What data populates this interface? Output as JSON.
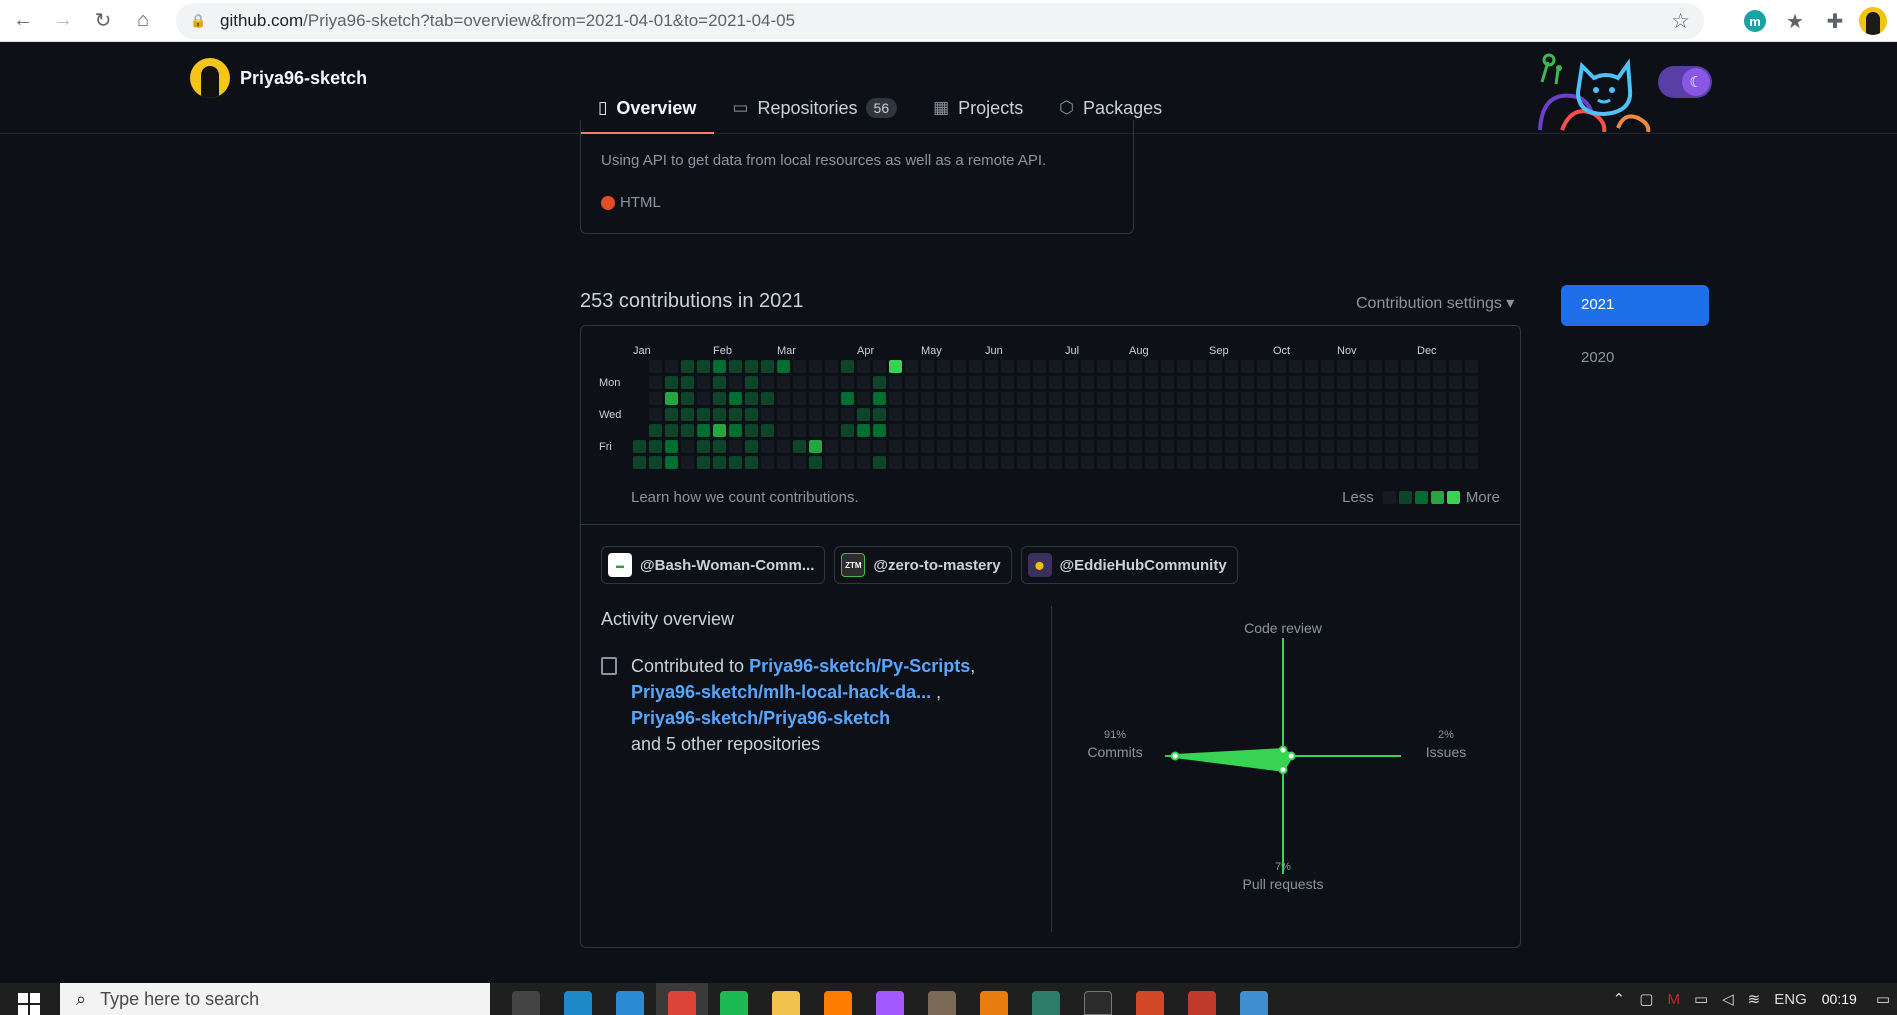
{
  "browser": {
    "url_host": "github.com",
    "url_path": "/Priya96-sketch?tab=overview&from=2021-04-01&to=2021-04-05",
    "extensions": [
      "m-extension-icon",
      "star-icon",
      "puzzle-icon"
    ]
  },
  "profile": {
    "username": "Priya96-sketch"
  },
  "tabs": [
    {
      "label": "Overview",
      "icon": "book-icon"
    },
    {
      "label": "Repositories",
      "icon": "repo-icon",
      "count": "56"
    },
    {
      "label": "Projects",
      "icon": "project-icon"
    },
    {
      "label": "Packages",
      "icon": "package-icon"
    }
  ],
  "pinned": {
    "description": "Using API to get data from local resources as well as a remote API.",
    "language": "HTML",
    "language_color": "#e34c26"
  },
  "contributions": {
    "title": "253 contributions in 2021",
    "settings_label": "Contribution settings",
    "months": [
      "Jan",
      "Feb",
      "Mar",
      "Apr",
      "May",
      "Jun",
      "Jul",
      "Aug",
      "Sep",
      "Oct",
      "Nov",
      "Dec"
    ],
    "day_labels": [
      "Mon",
      "Wed",
      "Fri"
    ],
    "learn_text": "Learn how we count contributions.",
    "legend_less": "Less",
    "legend_more": "More",
    "level_colors": [
      "#161b22",
      "#0e4429",
      "#006d32",
      "#26a641",
      "#39d353"
    ],
    "weeks": [
      [
        0,
        0,
        0,
        0,
        0,
        1,
        1
      ],
      [
        0,
        0,
        0,
        0,
        1,
        1,
        1
      ],
      [
        0,
        1,
        3,
        1,
        1,
        2,
        2
      ],
      [
        1,
        1,
        1,
        1,
        1,
        0,
        0
      ],
      [
        1,
        0,
        0,
        1,
        2,
        1,
        1
      ],
      [
        2,
        1,
        1,
        1,
        3,
        1,
        1
      ],
      [
        1,
        0,
        2,
        1,
        2,
        0,
        1
      ],
      [
        1,
        1,
        1,
        1,
        1,
        1,
        1
      ],
      [
        1,
        0,
        1,
        0,
        1,
        0,
        0
      ],
      [
        2,
        0,
        0,
        0,
        0,
        0,
        0
      ],
      [
        0,
        0,
        0,
        0,
        0,
        1,
        0
      ],
      [
        0,
        0,
        0,
        0,
        0,
        3,
        1
      ],
      [
        0,
        0,
        0,
        0,
        0,
        0,
        0
      ],
      [
        1,
        0,
        2,
        0,
        1,
        0,
        0
      ],
      [
        0,
        0,
        0,
        1,
        2,
        0,
        0
      ],
      [
        0,
        1,
        2,
        1,
        2,
        0,
        1
      ],
      [
        4,
        0,
        0,
        0,
        0,
        0,
        0
      ]
    ],
    "selected_year": "2021",
    "years": [
      "2021",
      "2020"
    ]
  },
  "organizations": [
    {
      "label": "@Bash-Woman-Comm...",
      "icon": "bash-woman-logo",
      "color": "#ffffff"
    },
    {
      "label": "@zero-to-mastery",
      "icon": "ztm-logo",
      "color": "#2d2d2d"
    },
    {
      "label": "@EddieHubCommunity",
      "icon": "eddiehub-logo",
      "color": "#3b2f5c"
    }
  ],
  "activity": {
    "title": "Activity overview",
    "contributed_prefix": "Contributed to",
    "repos": [
      "Priya96-sketch/Py-Scripts",
      "Priya96-sketch/mlh-local-hack-da...",
      "Priya96-sketch/Priya96-sketch"
    ],
    "sep1": ",",
    "sep2": " ,",
    "other": "and 5 other repositories",
    "radar": {
      "code_review_label": "Code review",
      "commits_label": "Commits",
      "commits_pct": "91%",
      "commits_value": 91,
      "issues_label": "Issues",
      "issues_pct": "2%",
      "issues_value": 2,
      "pull_requests_label": "Pull requests",
      "pull_requests_pct": "7%",
      "pull_requests_value": 7,
      "code_review_value": 0,
      "color": "#39d353"
    }
  },
  "taskbar": {
    "search_placeholder": "Type here to search",
    "language": "ENG",
    "time": "00:19"
  }
}
